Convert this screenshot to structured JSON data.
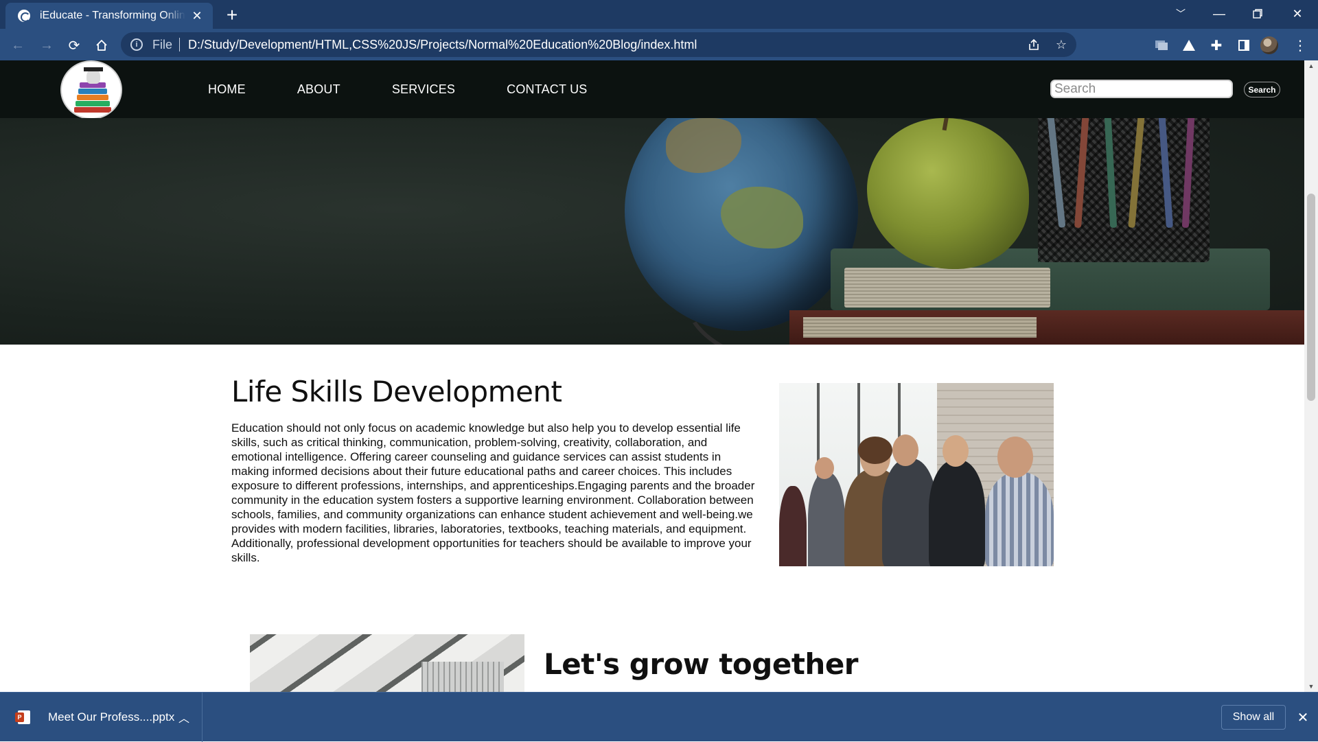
{
  "browser": {
    "tab_title": "iEducate - Transforming Online Education",
    "new_tab_symbol": "+",
    "address_scheme_label": "File",
    "address_url": "D:/Study/Development/HTML,CSS%20JS/Projects/Normal%20Education%20Blog/index.html",
    "icons": [
      "back-icon",
      "forward-icon",
      "reload-icon",
      "home-icon",
      "info-icon",
      "share-icon",
      "star-icon",
      "extension-icon",
      "puzzle-icon",
      "sidebar-icon",
      "menu-icon"
    ]
  },
  "site": {
    "nav": [
      "HOME",
      "ABOUT",
      "SERVICES",
      "CONTACT US"
    ],
    "search_placeholder": "Search",
    "search_button": "Search"
  },
  "section1": {
    "title": "Life Skills Development",
    "body": "Education should not only focus on academic knowledge but also help you to develop essential life skills, such as critical thinking, communication, problem-solving, creativity, collaboration, and emotional intelligence. Offering career counseling and guidance services can assist students in making informed decisions about their future educational paths and career choices. This includes exposure to different professions, internships, and apprenticeships.Engaging parents and the broader community in the education system fosters a supportive learning environment. Collaboration between schools, families, and community organizations can enhance student achievement and well-being.we provides with modern facilities, libraries, laboratories, textbooks, teaching materials, and equipment. Additionally, professional development opportunities for teachers should be available to improve your skills."
  },
  "section2": {
    "title": "Let's grow together"
  },
  "downloads": {
    "file_name": "Meet Our Profess....pptx",
    "show_all": "Show all"
  }
}
